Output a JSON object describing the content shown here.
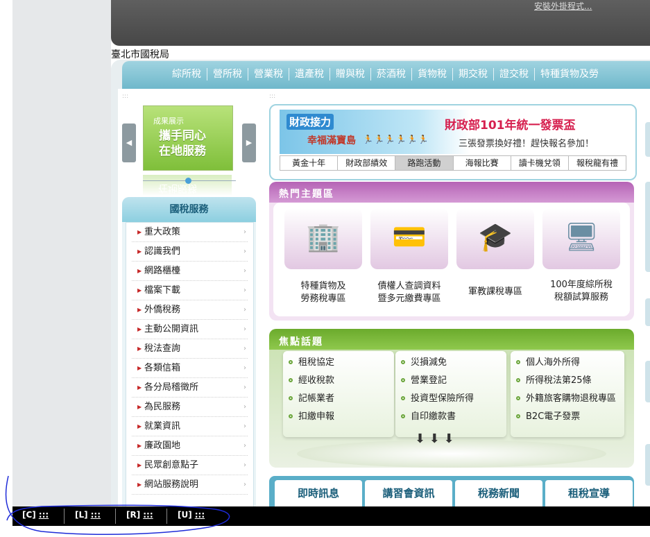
{
  "header": {
    "install_link": "安裝外掛程式...",
    "site_title": "臺北市國稅局"
  },
  "nav": {
    "items": [
      "綜所稅",
      "營所稅",
      "營業稅",
      "遺產稅",
      "贈與稅",
      "菸酒稅",
      "貨物稅",
      "期交稅",
      "證交稅",
      "特種貨物及勞"
    ]
  },
  "carousel": {
    "small_text": "成果展示",
    "headline_1": "攜手同心",
    "headline_2": "在地服務",
    "reflection": "在地服務"
  },
  "services": {
    "title": "國稅服務",
    "items": [
      "重大政策",
      "認識我們",
      "網路櫃檯",
      "檔案下載",
      "外僑稅務",
      "主動公開資訊",
      "稅法查詢",
      "各類信箱",
      "各分局稽徵所",
      "為民服務",
      "就業資訊",
      "廉政園地",
      "民眾創意點子",
      "網站服務說明"
    ]
  },
  "promo": {
    "tag": "財政接力",
    "subtag": "幸福滿寶島",
    "title": "財政部101年統一發票盃",
    "description": "三張發票換好禮！趕快報名參加！",
    "tabs": [
      "黃金十年",
      "財政部績效",
      "路跑活動",
      "海報比賽",
      "讀卡機兌領",
      "報稅龍有禮"
    ],
    "active_tab": "路跑活動"
  },
  "hot_topics": {
    "title": "熱門主題區",
    "cards": [
      {
        "line1": "特種貨物及",
        "line2": "勞務稅專區",
        "icon": "building-icon"
      },
      {
        "line1": "債權人查調資料",
        "line2": "暨多元繳費專區",
        "icon": "credit-card-icon"
      },
      {
        "line1": "軍教課稅專區",
        "line2": "",
        "icon": "teacher-icon"
      },
      {
        "line1": "100年度綜所稅",
        "line2": "稅額試算服務",
        "icon": "computer-icon"
      }
    ]
  },
  "focus": {
    "title": "焦點話題",
    "col1": [
      "租稅協定",
      "經收稅款",
      "記帳業者",
      "扣繳申報"
    ],
    "col2": [
      "災損減免",
      "營業登記",
      "投資型保險所得",
      "自印繳款書"
    ],
    "col3": [
      "個人海外所得",
      "所得稅法第25條",
      "外籍旅客購物退稅專區",
      "B2C電子發票"
    ]
  },
  "news": {
    "tabs": [
      "即時訊息",
      "講習會資訊",
      "稅務新聞",
      "租稅宣導"
    ]
  },
  "bottom_bar": {
    "items": [
      {
        "key": "[C]",
        "dots": ":::"
      },
      {
        "key": "[L]",
        "dots": ":::"
      },
      {
        "key": "[R]",
        "dots": ":::"
      },
      {
        "key": "[U]",
        "dots": ":::"
      }
    ]
  },
  "colors": {
    "nav_blue": "#6fb8cb",
    "hot_purple": "#b563b5",
    "focus_green": "#6bab2c",
    "menu_bullet": "#c62828"
  }
}
